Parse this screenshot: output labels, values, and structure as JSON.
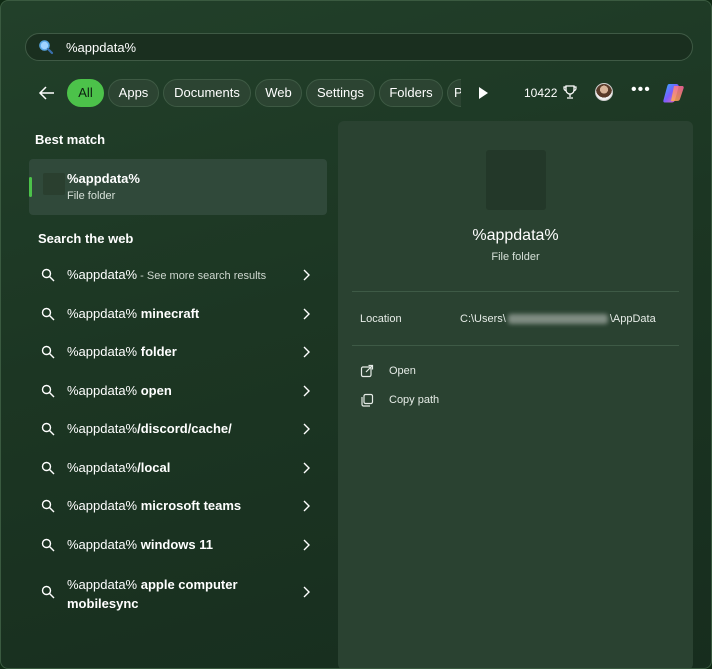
{
  "search": {
    "query": "%appdata%"
  },
  "tabs": {
    "items": [
      {
        "label": "All"
      },
      {
        "label": "Apps"
      },
      {
        "label": "Documents"
      },
      {
        "label": "Web"
      },
      {
        "label": "Settings"
      },
      {
        "label": "Folders"
      },
      {
        "label": "P"
      }
    ],
    "points": "10422"
  },
  "left": {
    "best_match_heading": "Best match",
    "best_match": {
      "title": "%appdata%",
      "subtitle": "File folder"
    },
    "web_heading": "Search the web",
    "web_results": [
      {
        "query": "%appdata%",
        "suffix": "",
        "hint": " - See more search results"
      },
      {
        "query": "%appdata%",
        "suffix": " minecraft",
        "hint": ""
      },
      {
        "query": "%appdata%",
        "suffix": " folder",
        "hint": ""
      },
      {
        "query": "%appdata%",
        "suffix": " open",
        "hint": ""
      },
      {
        "query": "%appdata%",
        "suffix": "/discord/cache/",
        "hint": ""
      },
      {
        "query": "%appdata%",
        "suffix": "/local",
        "hint": ""
      },
      {
        "query": "%appdata%",
        "suffix": " microsoft teams",
        "hint": ""
      },
      {
        "query": "%appdata%",
        "suffix": " windows 11",
        "hint": ""
      },
      {
        "query": "%appdata%",
        "suffix": " apple computer",
        "suffix2": "mobilesync",
        "hint": ""
      }
    ]
  },
  "detail": {
    "title": "%appdata%",
    "subtitle": "File folder",
    "location_label": "Location",
    "location_prefix": "C:\\Users\\",
    "location_suffix": "\\AppData",
    "actions": [
      {
        "label": "Open"
      },
      {
        "label": "Copy path"
      }
    ]
  },
  "colors": {
    "accent": "#4cc24a",
    "panel": "#2a4231"
  }
}
